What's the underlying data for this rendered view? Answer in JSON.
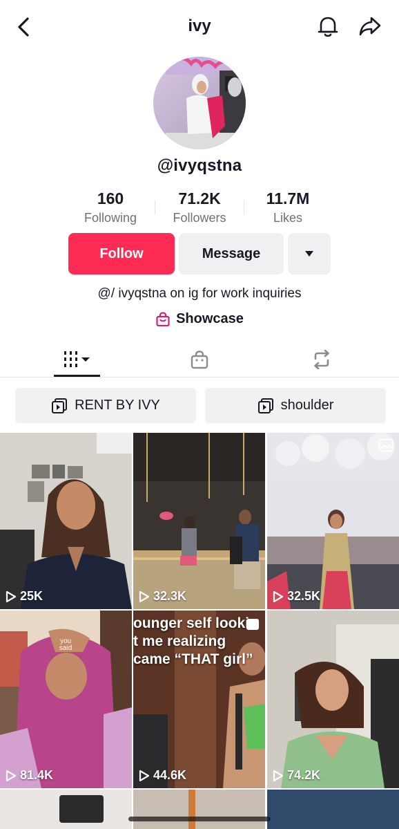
{
  "header": {
    "title": "ivy",
    "back_icon": "chevron-left-icon",
    "bell_icon": "bell-icon",
    "share_icon": "share-arrow-icon"
  },
  "profile": {
    "handle": "@ivyqstna",
    "stats": [
      {
        "value": "160",
        "label": "Following"
      },
      {
        "value": "71.2K",
        "label": "Followers"
      },
      {
        "value": "11.7M",
        "label": "Likes"
      }
    ],
    "follow_label": "Follow",
    "message_label": "Message",
    "bio": "@/ ivyqstna on ig for work inquiries",
    "showcase_label": "Showcase"
  },
  "tabs": [
    {
      "icon": "videos-grid-icon",
      "active": true
    },
    {
      "icon": "shop-bag-icon",
      "active": false
    },
    {
      "icon": "repost-icon",
      "active": false
    }
  ],
  "playlists": [
    {
      "label": "RENT BY IVY"
    },
    {
      "label": "shoulder"
    }
  ],
  "videos": [
    {
      "views": "25K"
    },
    {
      "views": "32.3K"
    },
    {
      "views": "32.5K"
    },
    {
      "views": "81.4K"
    },
    {
      "views": "44.6K",
      "overlay": [
        "ounger self lookin",
        "t me realizing",
        "came “THAT girl”"
      ]
    },
    {
      "views": "74.2K"
    }
  ],
  "colors": {
    "accent": "#fe2c55",
    "text": "#161823",
    "secondary": "#6e7079",
    "button_bg": "#f0f0f2"
  }
}
